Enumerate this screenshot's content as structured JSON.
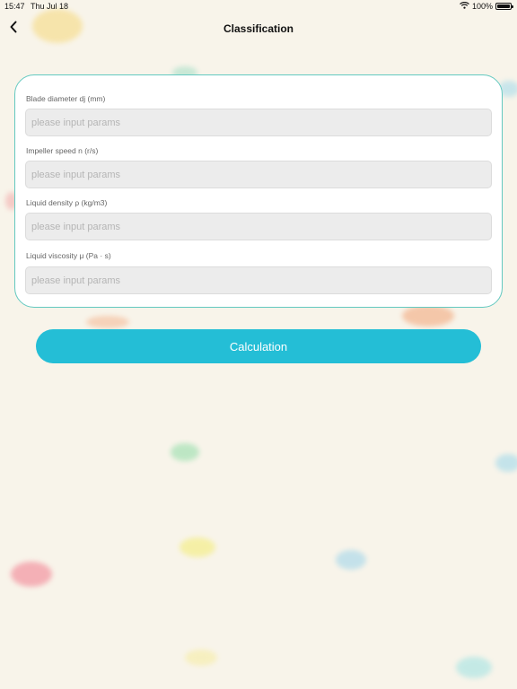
{
  "status_bar": {
    "time": "15:47",
    "date": "Thu Jul 18",
    "battery": "100%"
  },
  "nav": {
    "title": "Classification"
  },
  "form": {
    "fields": [
      {
        "label": "Blade diameter dj (mm)",
        "placeholder": "please input params",
        "value": ""
      },
      {
        "label": "Impeller speed n (r/s)",
        "placeholder": "please input params",
        "value": ""
      },
      {
        "label": "Liquid density ρ (kg/m3)",
        "placeholder": "please input params",
        "value": ""
      },
      {
        "label": "Liquid viscosity μ (Pa · s)",
        "placeholder": "please input params",
        "value": ""
      }
    ]
  },
  "action": {
    "calculate_label": "Calculation"
  },
  "colors": {
    "accent": "#24bed6",
    "card_border": "#63c9c0",
    "background": "#f8f4ea",
    "input_fill": "#ececec"
  },
  "icons": {
    "back": "chevron-left-icon",
    "wifi": "wifi-icon",
    "battery": "battery-icon"
  }
}
